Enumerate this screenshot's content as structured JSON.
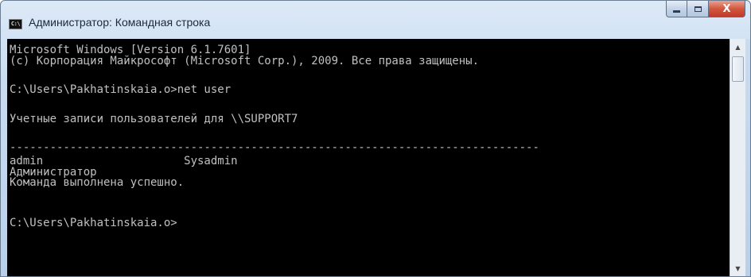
{
  "window": {
    "title": "Администратор: Командная строка",
    "app_icon_text": "C:\\",
    "controls": {
      "close_glyph": "X"
    }
  },
  "console": {
    "lines": [
      "Microsoft Windows [Version 6.1.7601]",
      "(c) Корпорация Майкрософт (Microsoft Corp.), 2009. Все права защищены.",
      "C:\\Users\\Pakhatinskaia.o>net user",
      "Учетные записи пользователей для \\\\SUPPORT7",
      "-------------------------------------------------------------------------------",
      "admin                     Sysadmin",
      "Администратор",
      "Команда выполнена успешно.",
      "C:\\Users\\Pakhatinskaia.o>"
    ]
  },
  "scrollbar": {
    "up_glyph": "▲",
    "down_glyph": "▼"
  }
}
